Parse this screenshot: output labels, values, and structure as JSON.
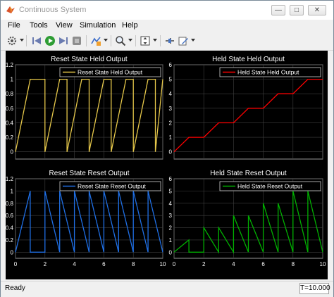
{
  "window": {
    "title": "Continuous System"
  },
  "window_controls": {
    "minimize": "—",
    "maximize": "□",
    "close": "✕"
  },
  "menu": [
    "File",
    "Tools",
    "View",
    "Simulation",
    "Help"
  ],
  "toolbar_icons": [
    "gear-icon",
    "step-back-icon",
    "run-icon",
    "step-forward-icon",
    "stop-icon",
    "signal-select-icon",
    "zoom-icon",
    "fit-axes-icon",
    "highlight-block-icon",
    "edit-icon"
  ],
  "status": {
    "left": "Ready",
    "right": "T=10.000"
  },
  "colors": {
    "plot_bg": "#000000",
    "grid": "#404040",
    "axis_text": "#ffffff",
    "yellow": "#e6c84a",
    "red": "#ff0000",
    "blue": "#1f6fe5",
    "green": "#00b000"
  },
  "chart_data": [
    {
      "type": "line",
      "title": "Reset State Held Output",
      "legend": "Reset State Held Output",
      "legend_position": "top-right",
      "color": "#e6c84a",
      "xlim": [
        0,
        10
      ],
      "ylim": [
        -0.1,
        1.2
      ],
      "xticks": [
        0,
        2,
        4,
        6,
        8,
        10
      ],
      "yticks": [
        0,
        0.2,
        0.4,
        0.6,
        0.8,
        1,
        1.2
      ],
      "ytick_labels": [
        "0",
        "0.2",
        "0.4",
        "0.6",
        "0.8",
        "1",
        "1.2"
      ],
      "grid": true,
      "x": [
        0,
        1,
        2,
        2,
        3,
        3.5,
        3.5,
        4.5,
        5,
        5,
        6,
        6.5,
        6.5,
        7.5,
        8,
        8,
        9,
        9.5,
        9.5,
        10
      ],
      "y": [
        0,
        1,
        1,
        0,
        1,
        1,
        0,
        1,
        1,
        0,
        1,
        1,
        0,
        1,
        1,
        0,
        1,
        1,
        0,
        1
      ]
    },
    {
      "type": "line",
      "title": "Held State Held Output",
      "legend": "Held State Held Output",
      "legend_position": "top-right",
      "color": "#ff0000",
      "xlim": [
        0,
        10
      ],
      "ylim": [
        -0.5,
        6
      ],
      "xticks": [
        0,
        2,
        4,
        6,
        8,
        10
      ],
      "yticks": [
        0,
        1,
        2,
        3,
        4,
        5,
        6
      ],
      "ytick_labels": [
        "0",
        "1",
        "2",
        "3",
        "4",
        "5",
        "6"
      ],
      "grid": true,
      "x": [
        0,
        1,
        2,
        3,
        4,
        5,
        6,
        7,
        8,
        9,
        10
      ],
      "y": [
        0,
        1,
        1,
        2,
        2,
        3,
        3,
        4,
        4,
        5,
        5
      ]
    },
    {
      "type": "line",
      "title": "Reset State Reset Output",
      "legend": "Reset State Reset Output",
      "legend_position": "top-right",
      "color": "#1f6fe5",
      "xlim": [
        0,
        10
      ],
      "ylim": [
        -0.1,
        1.2
      ],
      "xticks": [
        0,
        2,
        4,
        6,
        8,
        10
      ],
      "xtick_labels": [
        "0",
        "2",
        "4",
        "6",
        "8",
        "10"
      ],
      "yticks": [
        0,
        0.2,
        0.4,
        0.6,
        0.8,
        1,
        1.2
      ],
      "ytick_labels": [
        "0",
        "0.2",
        "0.4",
        "0.6",
        "0.8",
        "1",
        "1.2"
      ],
      "grid": true,
      "x": [
        0,
        1,
        1,
        2,
        2,
        3,
        3,
        4,
        4,
        5,
        5,
        6,
        6,
        7,
        7,
        8,
        8,
        9,
        9,
        10
      ],
      "y": [
        0,
        1,
        0,
        0,
        1,
        0,
        1,
        0,
        1,
        0,
        1,
        0,
        1,
        0,
        1,
        0,
        1,
        0,
        1,
        0
      ]
    },
    {
      "type": "line",
      "title": "Held State Reset Output",
      "legend": "Held State Reset Output",
      "legend_position": "top-right",
      "color": "#00b000",
      "xlim": [
        0,
        10
      ],
      "ylim": [
        -0.5,
        6
      ],
      "xticks": [
        0,
        2,
        4,
        6,
        8,
        10
      ],
      "xtick_labels": [
        "0",
        "2",
        "4",
        "6",
        "8",
        "10"
      ],
      "yticks": [
        0,
        1,
        2,
        3,
        4,
        5,
        6
      ],
      "ytick_labels": [
        "0",
        "1",
        "2",
        "3",
        "4",
        "5",
        "6"
      ],
      "grid": true,
      "x": [
        0,
        1,
        1,
        2,
        2,
        3,
        3,
        4,
        4,
        5,
        5,
        6,
        6,
        7,
        7,
        8,
        8,
        9,
        9,
        10
      ],
      "y": [
        0,
        1,
        0,
        0,
        2,
        0,
        2,
        0,
        3,
        0,
        3,
        0,
        4,
        0,
        4,
        0,
        5,
        0,
        5,
        0
      ]
    }
  ]
}
